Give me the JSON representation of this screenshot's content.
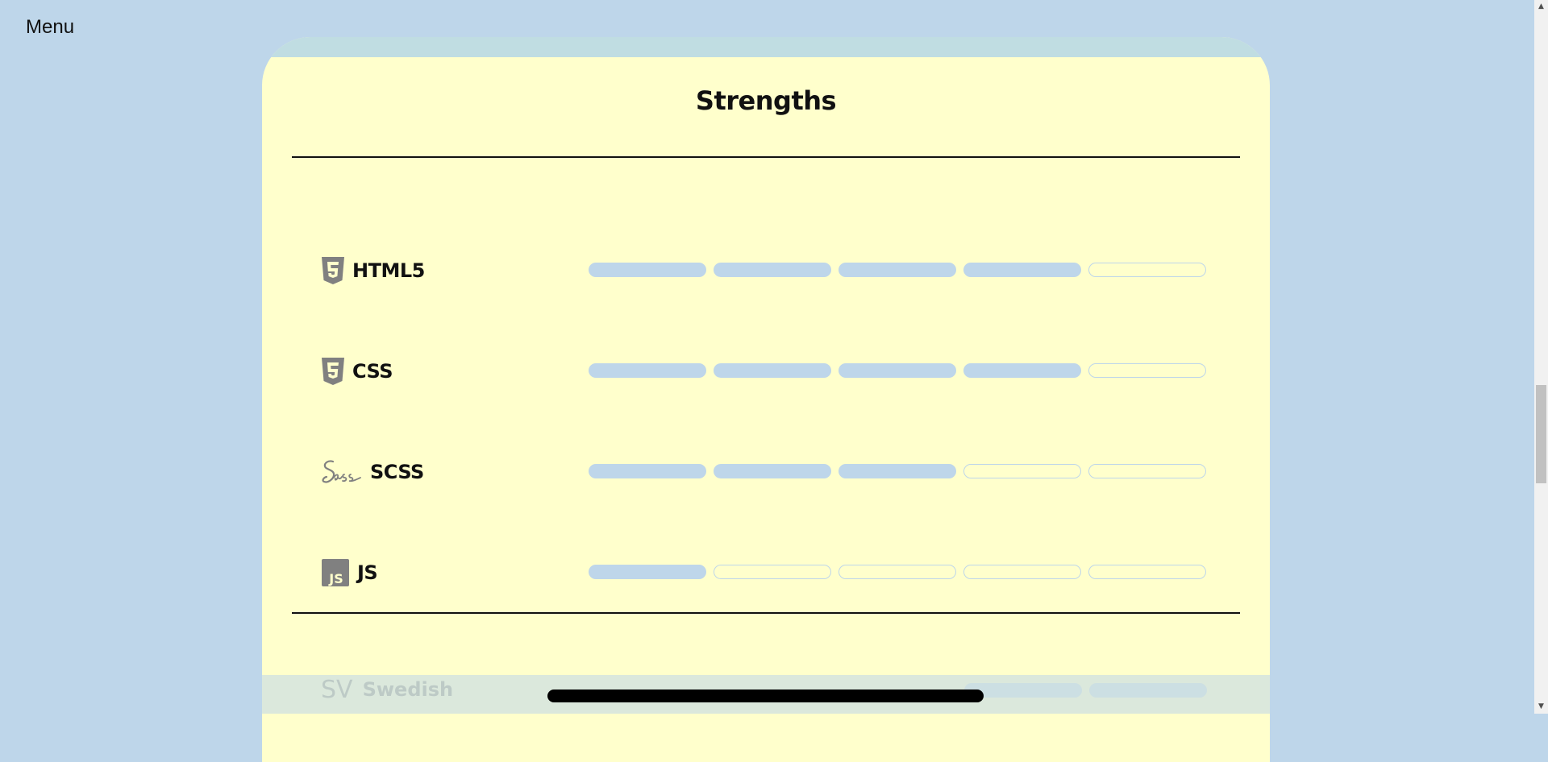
{
  "nav": {
    "menu_label": "Menu"
  },
  "section": {
    "title": "Strengths",
    "skills": [
      {
        "name": "HTML5",
        "icon": "html5-icon",
        "level": 4,
        "max": 5
      },
      {
        "name": "CSS",
        "icon": "css3-icon",
        "level": 4,
        "max": 5
      },
      {
        "name": "SCSS",
        "icon": "sass-icon",
        "level": 3,
        "max": 5
      },
      {
        "name": "JS",
        "icon": "js-icon",
        "level": 1,
        "max": 5
      }
    ]
  },
  "languages": [
    {
      "code": "SV",
      "name": "Swedish"
    }
  ],
  "colors": {
    "background": "#bed6ea",
    "card": "#ffffcc",
    "bar_fill": "#bed6ea",
    "text": "#111111",
    "icon": "#808080"
  }
}
